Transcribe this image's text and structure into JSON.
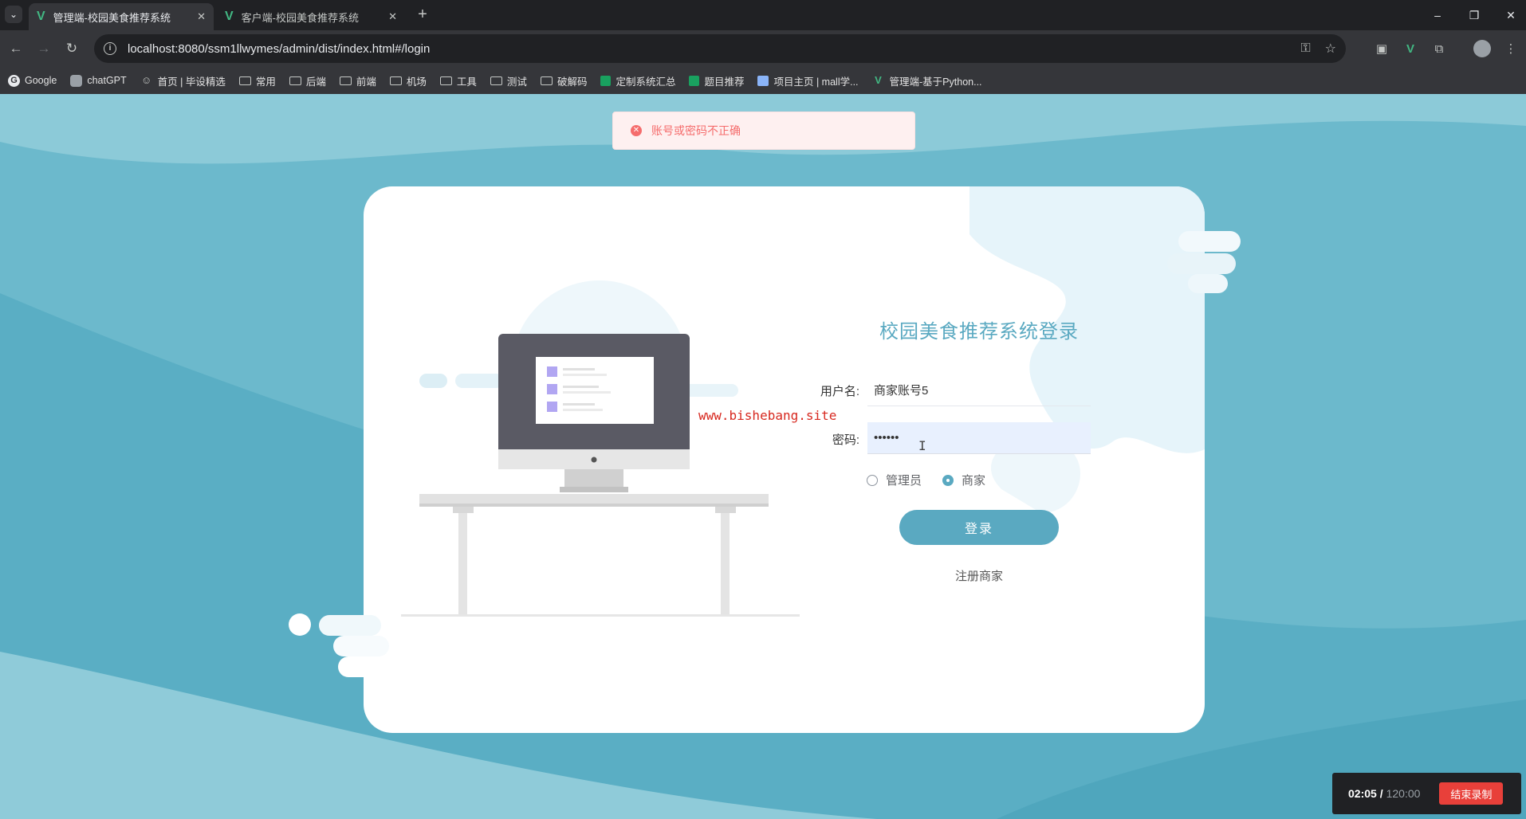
{
  "browser": {
    "tabs": [
      {
        "title": "管理端-校园美食推荐系统",
        "active": true
      },
      {
        "title": "客户端-校园美食推荐系统",
        "active": false
      }
    ],
    "new_tab": "+",
    "url": "localhost:8080/ssm1llwymes/admin/dist/index.html#/login",
    "window_controls": {
      "minimize": "–",
      "restore": "❐",
      "close": "✕"
    },
    "bookmarks": [
      {
        "label": "Google",
        "icon": "google-icon"
      },
      {
        "label": "chatGPT",
        "icon": "chatgpt-icon"
      },
      {
        "label": "首页 | 毕设精选",
        "icon": "bishe-icon"
      },
      {
        "label": "常用",
        "icon": "folder-icon"
      },
      {
        "label": "后端",
        "icon": "folder-icon"
      },
      {
        "label": "前端",
        "icon": "folder-icon"
      },
      {
        "label": "机场",
        "icon": "folder-icon"
      },
      {
        "label": "工具",
        "icon": "folder-icon"
      },
      {
        "label": "测试",
        "icon": "folder-icon"
      },
      {
        "label": "破解码",
        "icon": "folder-icon"
      },
      {
        "label": "定制系统汇总",
        "icon": "sheet-icon"
      },
      {
        "label": "题目推荐",
        "icon": "sheet-icon"
      },
      {
        "label": "项目主页 | mall学...",
        "icon": "page-icon"
      },
      {
        "label": "管理端-基于Python...",
        "icon": "vue-icon"
      }
    ]
  },
  "alert": {
    "message": "账号或密码不正确",
    "type": "error"
  },
  "login": {
    "title": "校园美食推荐系统登录",
    "username_label": "用户名:",
    "username_value": "商家账号5",
    "password_label": "密码:",
    "password_value": "••••••",
    "roles": [
      {
        "label": "管理员",
        "checked": false
      },
      {
        "label": "商家",
        "checked": true
      }
    ],
    "submit_label": "登录",
    "register_label": "注册商家"
  },
  "watermark": "www.bishebang.site",
  "recorder": {
    "elapsed": "02:05 /",
    "total": "120:00",
    "stop_label": "结束录制"
  },
  "colors": {
    "accent": "#5aa9c1",
    "background": "#8ccad8",
    "error": "#f56c6c"
  }
}
